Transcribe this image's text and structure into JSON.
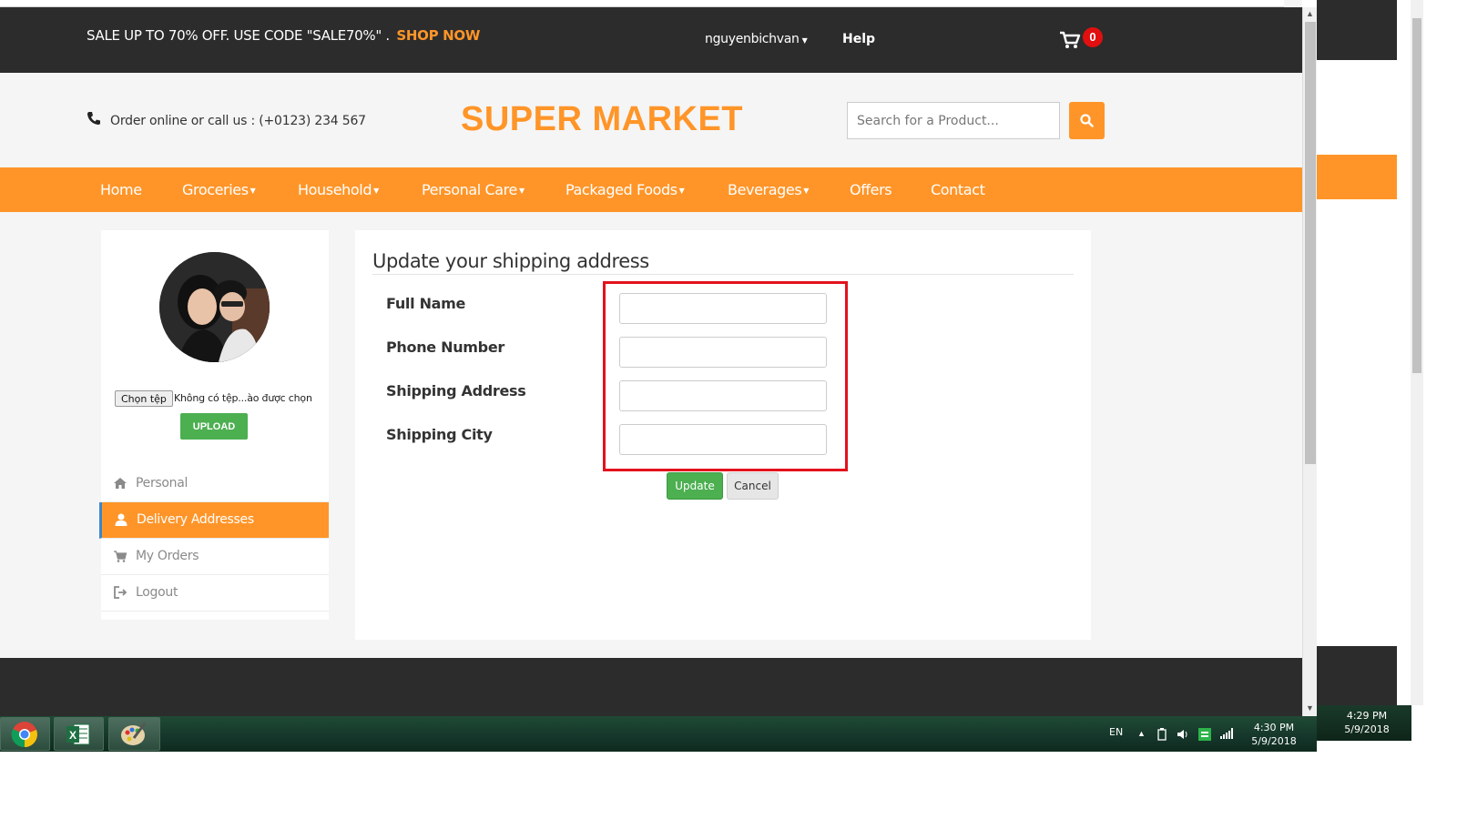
{
  "topbar": {
    "promo_text": "SALE UP TO 70% OFF. USE CODE \"SALE70%\" .",
    "promo_link": "SHOP NOW",
    "username": "nguyenbichvan",
    "help": "Help",
    "cart_count": "0"
  },
  "header": {
    "order_text": "Order online or call us : (+0123) 234 567",
    "logo": "SUPER MARKET",
    "search_placeholder": "Search for a Product..."
  },
  "nav": {
    "items": [
      {
        "label": "Home",
        "dropdown": false
      },
      {
        "label": "Groceries",
        "dropdown": true
      },
      {
        "label": "Household",
        "dropdown": true
      },
      {
        "label": "Personal Care",
        "dropdown": true
      },
      {
        "label": "Packaged Foods",
        "dropdown": true
      },
      {
        "label": "Beverages",
        "dropdown": true
      },
      {
        "label": "Offers",
        "dropdown": false
      },
      {
        "label": "Contact",
        "dropdown": false
      }
    ]
  },
  "sidebar": {
    "file_button": "Chọn tệp",
    "file_status": "Không có tệp...ào được chọn",
    "upload": "UPLOAD",
    "items": [
      {
        "label": "Personal",
        "icon": "home-icon",
        "active": false
      },
      {
        "label": "Delivery Addresses",
        "icon": "user-icon",
        "active": true
      },
      {
        "label": "My Orders",
        "icon": "cart-icon",
        "active": false
      },
      {
        "label": "Logout",
        "icon": "logout-icon",
        "active": false
      }
    ]
  },
  "form": {
    "title": "Update your shipping address",
    "fields": [
      {
        "label": "Full Name",
        "value": ""
      },
      {
        "label": "Phone Number",
        "value": ""
      },
      {
        "label": "Shipping Address",
        "value": ""
      },
      {
        "label": "Shipping City",
        "value": ""
      }
    ],
    "update": "Update",
    "cancel": "Cancel"
  },
  "taskbar": {
    "lang": "EN",
    "time": "4:30 PM",
    "date": "5/9/2018",
    "apps": [
      "chrome-icon",
      "excel-icon",
      "paint-icon"
    ]
  },
  "second_window": {
    "time": "4:29 PM",
    "date": "5/9/2018"
  },
  "colors": {
    "accent": "#ff9528",
    "dark": "#2c2c2c",
    "success": "#4caf50",
    "highlight": "#e3121c"
  }
}
